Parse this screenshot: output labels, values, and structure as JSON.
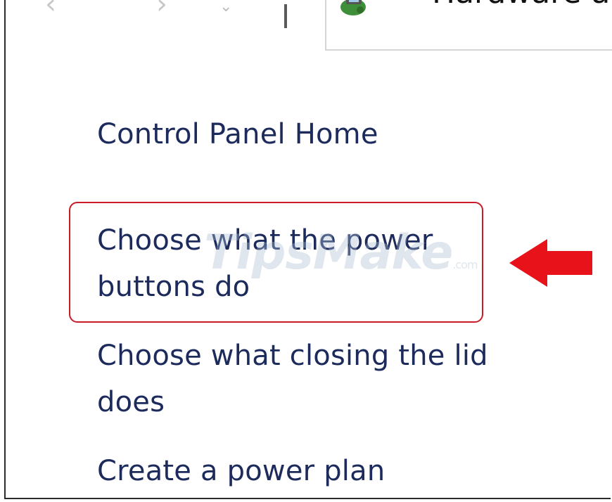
{
  "nav": {
    "back_icon": "back-arrow-icon",
    "forward_icon": "forward-arrow-icon",
    "recent_icon": "chevron-down-icon",
    "up_icon": "up-arrow-icon"
  },
  "address_bar": {
    "icon": "hardware-and-sound-icon",
    "separator": "«",
    "text": "Hardware a"
  },
  "sidebar": {
    "links": [
      {
        "label": "Control Panel Home"
      },
      {
        "label": "Choose what the power\nbuttons do"
      },
      {
        "label": "Choose what closing the lid\ndoes"
      },
      {
        "label": "Create a power plan"
      }
    ]
  },
  "annotation": {
    "highlight_color": "#c81c27",
    "arrow_color": "#e8121a",
    "arrow_icon": "left-arrow-icon"
  },
  "watermark": {
    "text": "TipsMake",
    "tld": ".com"
  },
  "colors": {
    "link": "#1c2b5c",
    "background": "#ffffff"
  }
}
